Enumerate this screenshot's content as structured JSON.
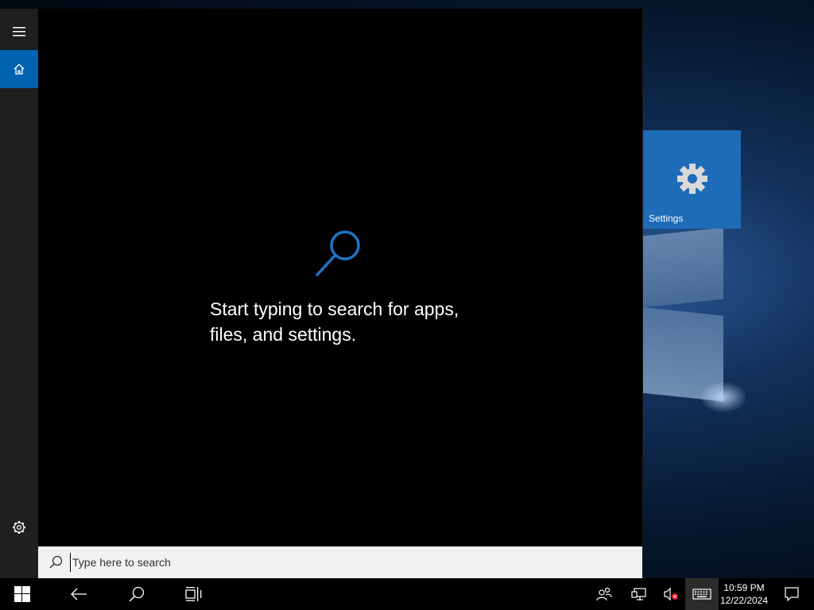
{
  "search": {
    "hint_line1": "Start typing to search for apps,",
    "hint_line2": "files, and settings.",
    "placeholder": "Type here to search"
  },
  "sidebar": {
    "items": [
      {
        "icon": "hamburger-menu-icon"
      },
      {
        "icon": "home-icon",
        "selected": true
      },
      {
        "icon": "gear-icon"
      }
    ]
  },
  "tiles": [
    {
      "label": "Settings",
      "icon": "gear-icon",
      "color": "#1e6bb8"
    }
  ],
  "taskbar": {
    "time": "10:59 PM",
    "date": "12/22/2024",
    "icons": [
      "windows-start-icon",
      "back-arrow-icon",
      "search-icon",
      "task-view-icon",
      "people-icon",
      "network-icon",
      "volume-muted-icon",
      "touch-keyboard-icon",
      "action-center-icon"
    ]
  },
  "colors": {
    "accent": "#0063b1",
    "tile": "#1e6bb8",
    "search_icon": "#1e73c8",
    "muted_badge": "#e81123"
  }
}
